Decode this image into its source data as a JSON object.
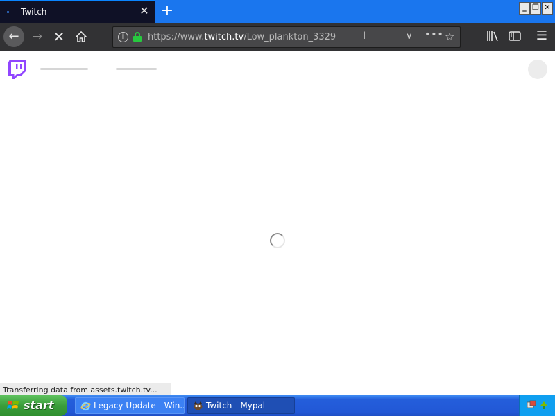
{
  "browser": {
    "tab": {
      "title": "Twitch"
    },
    "url": {
      "prefix": "https://www.",
      "domain": "twitch.tv",
      "path": "/Low_plankton_3329"
    }
  },
  "page": {
    "status_text": "Transferring data from assets.twitch.tv..."
  },
  "taskbar": {
    "start_label": "start",
    "items": [
      {
        "label": "Legacy Update - Win..."
      },
      {
        "label": "Twitch - Mypal"
      }
    ]
  },
  "colors": {
    "tab_background": "#0f1126",
    "tabstrip": "#1a76ee",
    "toolbar": "#323234",
    "twitch_purple": "#9146ff",
    "lock_green": "#27c93f"
  }
}
